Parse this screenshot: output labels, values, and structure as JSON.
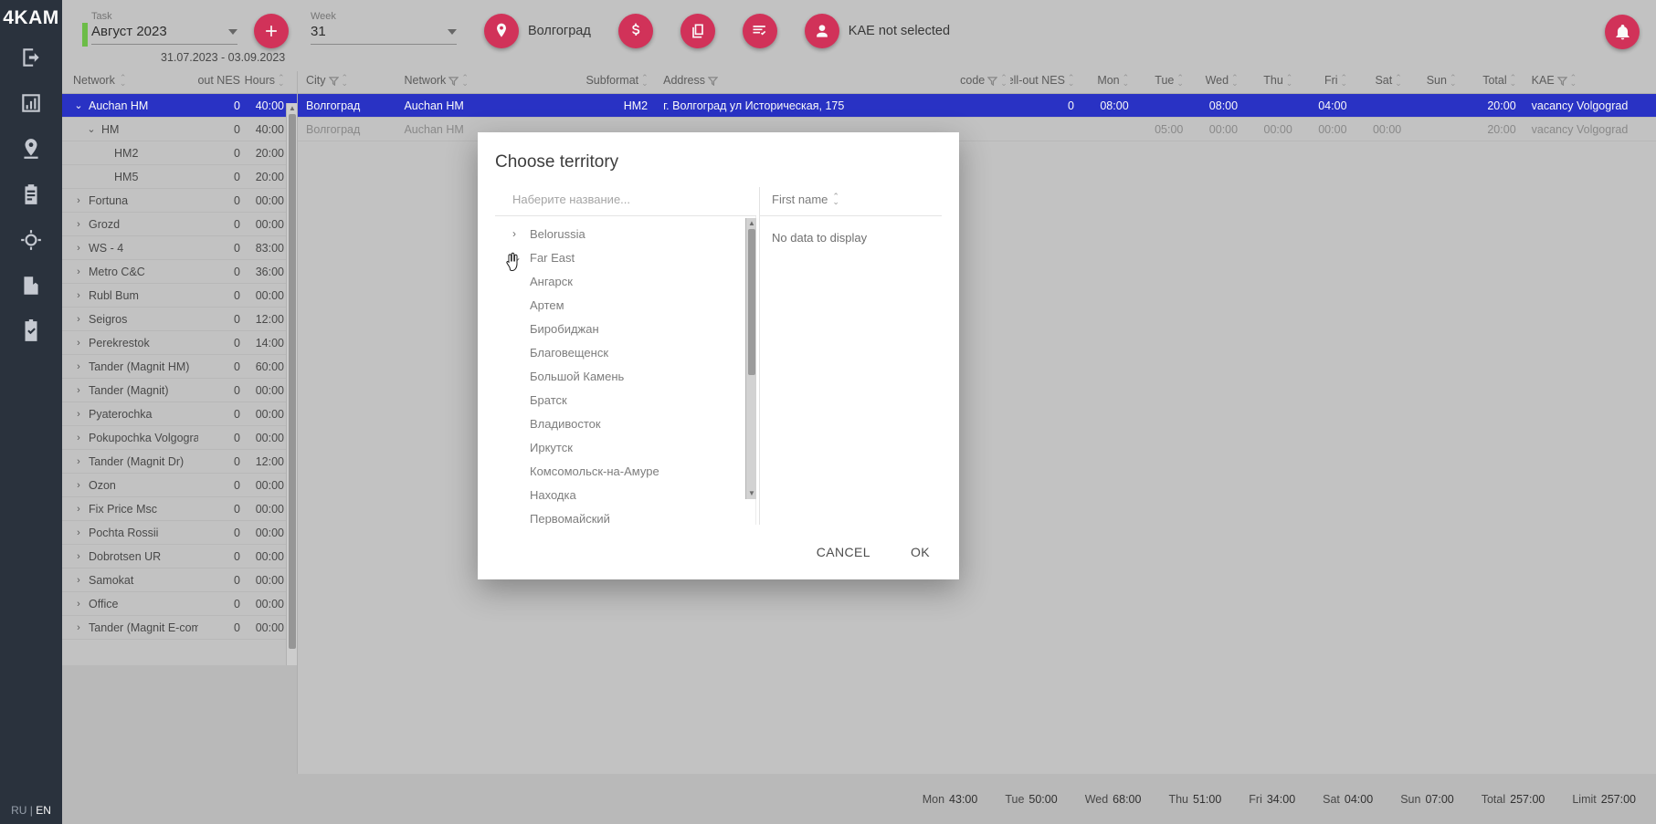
{
  "app": {
    "logo": "4KAM",
    "lang_ru": "RU",
    "lang_sep": "|",
    "lang_en": "EN"
  },
  "rail": {
    "items": [
      {
        "name": "logout-icon",
        "label": "logout-icon"
      },
      {
        "name": "chart-icon",
        "label": "chart-icon"
      },
      {
        "name": "location-icon",
        "label": "location-icon"
      },
      {
        "name": "clipboard-icon",
        "label": "clipboard-icon"
      },
      {
        "name": "target-icon",
        "label": "target-icon"
      },
      {
        "name": "book-icon",
        "label": "book-icon"
      },
      {
        "name": "checklist-icon",
        "label": "checklist-icon"
      }
    ]
  },
  "topbar": {
    "task_label": "Task",
    "task_value": "Август 2023",
    "week_label": "Week",
    "week_value": "31",
    "date_range": "31.07.2023 - 03.09.2023",
    "city_button": "Волгоград",
    "kae_button": "KAE not selected",
    "icons": {
      "add": "plus-icon",
      "location": "location-pin-icon",
      "money": "dollar-icon",
      "copy": "copy-icon",
      "tasks": "task-list-icon",
      "user": "user-icon",
      "bell": "notification-icon"
    }
  },
  "left_table": {
    "headers": [
      "Network",
      "Sell-out NES",
      "Hours"
    ],
    "rows": [
      {
        "name": "Auchan HM",
        "sell": "0",
        "hours": "40:00",
        "level": 0,
        "expanded": true,
        "selected": true
      },
      {
        "name": "HM",
        "sell": "0",
        "hours": "40:00",
        "level": 1,
        "expanded": true,
        "selected": false
      },
      {
        "name": "HM2",
        "sell": "0",
        "hours": "20:00",
        "level": 2,
        "expanded": null,
        "selected": false
      },
      {
        "name": "HM5",
        "sell": "0",
        "hours": "20:00",
        "level": 2,
        "expanded": null,
        "selected": false
      },
      {
        "name": "Fortuna",
        "sell": "0",
        "hours": "00:00",
        "level": 0,
        "expanded": false,
        "selected": false
      },
      {
        "name": "Grozd",
        "sell": "0",
        "hours": "00:00",
        "level": 0,
        "expanded": false,
        "selected": false
      },
      {
        "name": "WS - 4",
        "sell": "0",
        "hours": "83:00",
        "level": 0,
        "expanded": false,
        "selected": false
      },
      {
        "name": "Metro C&C",
        "sell": "0",
        "hours": "36:00",
        "level": 0,
        "expanded": false,
        "selected": false
      },
      {
        "name": "Rubl Bum",
        "sell": "0",
        "hours": "00:00",
        "level": 0,
        "expanded": false,
        "selected": false
      },
      {
        "name": "Seigros",
        "sell": "0",
        "hours": "12:00",
        "level": 0,
        "expanded": false,
        "selected": false
      },
      {
        "name": "Perekrestok",
        "sell": "0",
        "hours": "14:00",
        "level": 0,
        "expanded": false,
        "selected": false
      },
      {
        "name": "Tander (Magnit HM)",
        "sell": "0",
        "hours": "60:00",
        "level": 0,
        "expanded": false,
        "selected": false
      },
      {
        "name": "Tander (Magnit)",
        "sell": "0",
        "hours": "00:00",
        "level": 0,
        "expanded": false,
        "selected": false
      },
      {
        "name": "Pyaterochka",
        "sell": "0",
        "hours": "00:00",
        "level": 0,
        "expanded": false,
        "selected": false
      },
      {
        "name": "Pokupochka Volgograd",
        "sell": "0",
        "hours": "00:00",
        "level": 0,
        "expanded": false,
        "selected": false
      },
      {
        "name": "Tander (Magnit Dr)",
        "sell": "0",
        "hours": "12:00",
        "level": 0,
        "expanded": false,
        "selected": false
      },
      {
        "name": "Ozon",
        "sell": "0",
        "hours": "00:00",
        "level": 0,
        "expanded": false,
        "selected": false
      },
      {
        "name": "Fix Price Msc",
        "sell": "0",
        "hours": "00:00",
        "level": 0,
        "expanded": false,
        "selected": false
      },
      {
        "name": "Pochta Rossii",
        "sell": "0",
        "hours": "00:00",
        "level": 0,
        "expanded": false,
        "selected": false
      },
      {
        "name": "Dobrotsen UR",
        "sell": "0",
        "hours": "00:00",
        "level": 0,
        "expanded": false,
        "selected": false
      },
      {
        "name": "Samokat",
        "sell": "0",
        "hours": "00:00",
        "level": 0,
        "expanded": false,
        "selected": false
      },
      {
        "name": "Office",
        "sell": "0",
        "hours": "00:00",
        "level": 0,
        "expanded": false,
        "selected": false
      },
      {
        "name": "Tander (Magnit E-com)",
        "sell": "0",
        "hours": "00:00",
        "level": 0,
        "expanded": false,
        "selected": false
      }
    ]
  },
  "main_table": {
    "headers": [
      {
        "label": "City",
        "filter": true,
        "sort": true
      },
      {
        "label": "Network",
        "filter": true,
        "sort": true
      },
      {
        "label": "Subformat",
        "filter": false,
        "sort": true
      },
      {
        "label": "Address",
        "filter": true,
        "sort": false
      },
      {
        "label": "code",
        "filter": true,
        "sort": true
      },
      {
        "label": "Sell-out NES",
        "filter": false,
        "sort": true
      },
      {
        "label": "Mon",
        "filter": false,
        "sort": true
      },
      {
        "label": "Tue",
        "filter": false,
        "sort": true
      },
      {
        "label": "Wed",
        "filter": false,
        "sort": true
      },
      {
        "label": "Thu",
        "filter": false,
        "sort": true
      },
      {
        "label": "Fri",
        "filter": false,
        "sort": true
      },
      {
        "label": "Sat",
        "filter": false,
        "sort": true
      },
      {
        "label": "Sun",
        "filter": false,
        "sort": true
      },
      {
        "label": "Total",
        "filter": false,
        "sort": true
      },
      {
        "label": "KAE",
        "filter": true,
        "sort": true
      }
    ],
    "rows": [
      {
        "city": "Волгоград",
        "network": "Auchan HM",
        "subformat": "HM2",
        "address": "г. Волгоград ул Историческая, 175",
        "code": "",
        "sell": "0",
        "mon": "08:00",
        "tue": "",
        "wed": "08:00",
        "thu": "",
        "fri": "04:00",
        "sat": "",
        "sun": "",
        "total": "20:00",
        "kae": "vacancy Volgograd",
        "selected": true,
        "dim": false
      },
      {
        "city": "Волгоград",
        "network": "Auchan HM",
        "subformat": "",
        "address": "",
        "code": "",
        "sell": "",
        "mon": "",
        "tue": "05:00",
        "wed": "00:00",
        "thu": "00:00",
        "fri": "00:00",
        "sat": "00:00",
        "sun": "",
        "total": "20:00",
        "kae": "vacancy Volgograd",
        "selected": false,
        "dim": true
      }
    ]
  },
  "statusbar": {
    "items": [
      {
        "label": "Mon",
        "value": "43:00"
      },
      {
        "label": "Tue",
        "value": "50:00"
      },
      {
        "label": "Wed",
        "value": "68:00"
      },
      {
        "label": "Thu",
        "value": "51:00"
      },
      {
        "label": "Fri",
        "value": "34:00"
      },
      {
        "label": "Sat",
        "value": "04:00"
      },
      {
        "label": "Sun",
        "value": "07:00"
      },
      {
        "label": "Total",
        "value": "257:00"
      },
      {
        "label": "Limit",
        "value": "257:00"
      }
    ]
  },
  "modal": {
    "title": "Choose territory",
    "search_placeholder": "Наберите название...",
    "right_header": "First name",
    "no_data": "No data to display",
    "cancel": "CANCEL",
    "ok": "OK",
    "tree": [
      {
        "label": "Belorussia",
        "type": "group",
        "expanded": false
      },
      {
        "label": "Far East",
        "type": "group",
        "expanded": true
      },
      {
        "label": "Ангарск",
        "type": "child"
      },
      {
        "label": "Артем",
        "type": "child"
      },
      {
        "label": "Биробиджан",
        "type": "child"
      },
      {
        "label": "Благовещенск",
        "type": "child"
      },
      {
        "label": "Большой Камень",
        "type": "child"
      },
      {
        "label": "Братск",
        "type": "child"
      },
      {
        "label": "Владивосток",
        "type": "child"
      },
      {
        "label": "Иркутск",
        "type": "child"
      },
      {
        "label": "Комсомольск-на-Амуре",
        "type": "child"
      },
      {
        "label": "Находка",
        "type": "child"
      },
      {
        "label": "Первомайский",
        "type": "child"
      }
    ]
  },
  "colors": {
    "accent": "#d6335b",
    "selected_row": "#2a33c8",
    "rail_bg": "#2b333f",
    "panel_bg": "#c6c6c6",
    "task_bar": "#6fc04a"
  }
}
